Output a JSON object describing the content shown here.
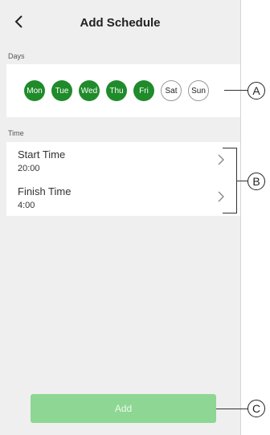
{
  "header": {
    "title": "Add Schedule",
    "back_icon": "chevron-left-icon"
  },
  "days_section": {
    "label": "Days",
    "days": [
      {
        "label": "Mon",
        "selected": true
      },
      {
        "label": "Tue",
        "selected": true
      },
      {
        "label": "Wed",
        "selected": true
      },
      {
        "label": "Thu",
        "selected": true
      },
      {
        "label": "Fri",
        "selected": true
      },
      {
        "label": "Sat",
        "selected": false
      },
      {
        "label": "Sun",
        "selected": false
      }
    ]
  },
  "time_section": {
    "label": "Time",
    "rows": [
      {
        "label": "Start Time",
        "value": "20:00"
      },
      {
        "label": "Finish Time",
        "value": "4:00"
      }
    ]
  },
  "add_button": {
    "label": "Add"
  },
  "callouts": {
    "a": "A",
    "b": "B",
    "c": "C"
  },
  "colors": {
    "selected_day": "#1f8b2a",
    "add_button": "#8ed694",
    "background": "#efefef"
  }
}
